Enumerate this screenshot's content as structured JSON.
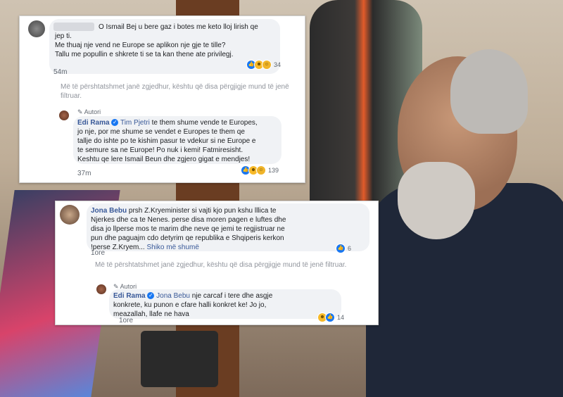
{
  "comments": {
    "c1": {
      "lines": [
        "O Ismail Bej u bere gaz i botes me keto lloj lirish qe",
        "jep ti.",
        "Me thuaj nje vend ne Europe se aplikon nje gje te tille?",
        "Tallu me popullin e shkrete ti se ta kan thene ate privilegj."
      ],
      "time": "54m",
      "reaction_count": "34"
    },
    "filtered_1": "Më të përshtatshmet janë zgjedhur, kështu që disa përgjigje mund të jenë filtruar.",
    "reply1": {
      "author_label": "Autori",
      "author": "Edi Rama",
      "mention": "Tim Pjetri",
      "first_line_rest": " te them shume vende te Europes,",
      "lines": [
        "jo nje, por me shume se vendet e Europes te them qe",
        "tallje do ishte po te kishim pasur te vdekur si ne Europe e",
        "te semure sa ne Europe! Po nuk i kemi! Fatmiresisht.",
        "Keshtu qe lere Ismail Beun dhe zgjero gigat e mendjes!"
      ],
      "time": "37m",
      "reaction_count": "139"
    },
    "c2": {
      "author": "Jona Bebu",
      "first_line_rest": " prsh Z.Kryeminister si vajti kjo pun kshu lllica te",
      "lines": [
        "Njerkes dhe ca te Nenes. perse disa moren pagen e luftes dhe",
        "disa jo llperse mos te marim dhe neve qe jemi te regjistruar ne",
        "pun dhe paguajm cdo detyrim qe republika e Shqiperis kerkon",
        "!perse Z.Kryem..."
      ],
      "see_more": "Shiko më shumë",
      "time": "1ore",
      "reaction_count": "6"
    },
    "filtered_2": "Më të përshtatshmet janë zgjedhur, kështu që disa përgjigje mund të jenë filtruar.",
    "reply2": {
      "author_label": "Autori",
      "author": "Edi Rama",
      "mention": "Jona Bebu",
      "first_line_rest": " nje carcaf i tere dhe asgje",
      "lines": [
        "konkrete, ku punon e cfare halli konkret ke! Jo jo,",
        "meazallah, llafe ne hava"
      ],
      "time": "1ore",
      "reaction_count": "14"
    }
  },
  "colors": {
    "link": "#385898",
    "bubble": "#f0f2f5",
    "like": "#1877f2"
  },
  "icons": [
    "pencil-icon",
    "verified-badge-icon",
    "like-reaction-icon",
    "haha-reaction-icon",
    "wow-reaction-icon"
  ]
}
